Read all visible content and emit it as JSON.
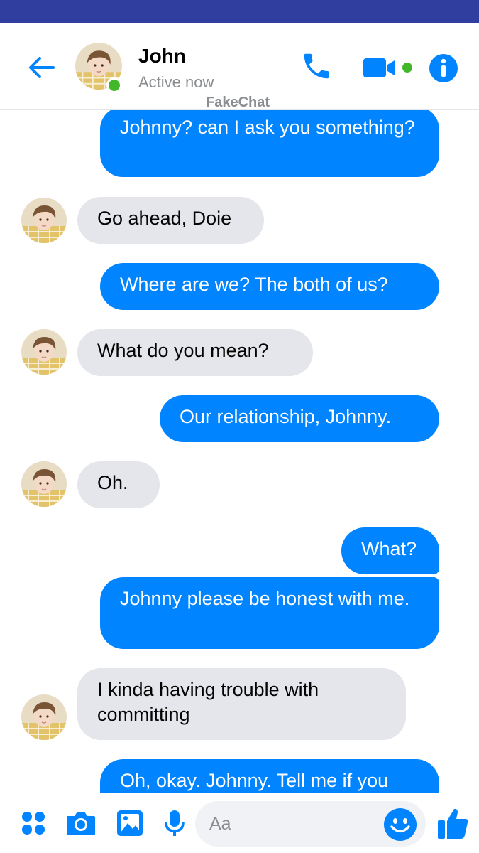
{
  "colors": {
    "accent": "#0084ff",
    "status_bar": "#303f9f",
    "incoming_bubble": "#e4e6eb",
    "online": "#42b72a"
  },
  "header": {
    "back_icon": "arrow-left-icon",
    "contact_name": "John",
    "status": "Active now",
    "watermark": "FakeChat",
    "actions": [
      {
        "icon": "phone-icon"
      },
      {
        "icon": "video-camera-icon"
      },
      {
        "icon": "info-icon"
      }
    ]
  },
  "messages": [
    {
      "direction": "out",
      "text": "Johnny? can I ask you something?"
    },
    {
      "direction": "in",
      "text": "Go ahead, Doie"
    },
    {
      "direction": "out",
      "text": "Where are we?  The both of us?"
    },
    {
      "direction": "in",
      "text": "What do you mean?"
    },
    {
      "direction": "out",
      "text": "Our relationship, Johnny."
    },
    {
      "direction": "in",
      "text": "Oh."
    },
    {
      "direction": "out",
      "text": "What?"
    },
    {
      "direction": "out",
      "text": "Johnny please be honest with me."
    },
    {
      "direction": "in",
      "text": "I kinda having trouble with committing"
    },
    {
      "direction": "out",
      "text": "Oh, okay. Johnny. Tell me if you"
    }
  ],
  "composer": {
    "icons": [
      "apps-grid-icon",
      "camera-icon",
      "gallery-icon",
      "microphone-icon",
      "emoji-icon",
      "thumbs-up-icon"
    ],
    "placeholder": "Aa"
  }
}
